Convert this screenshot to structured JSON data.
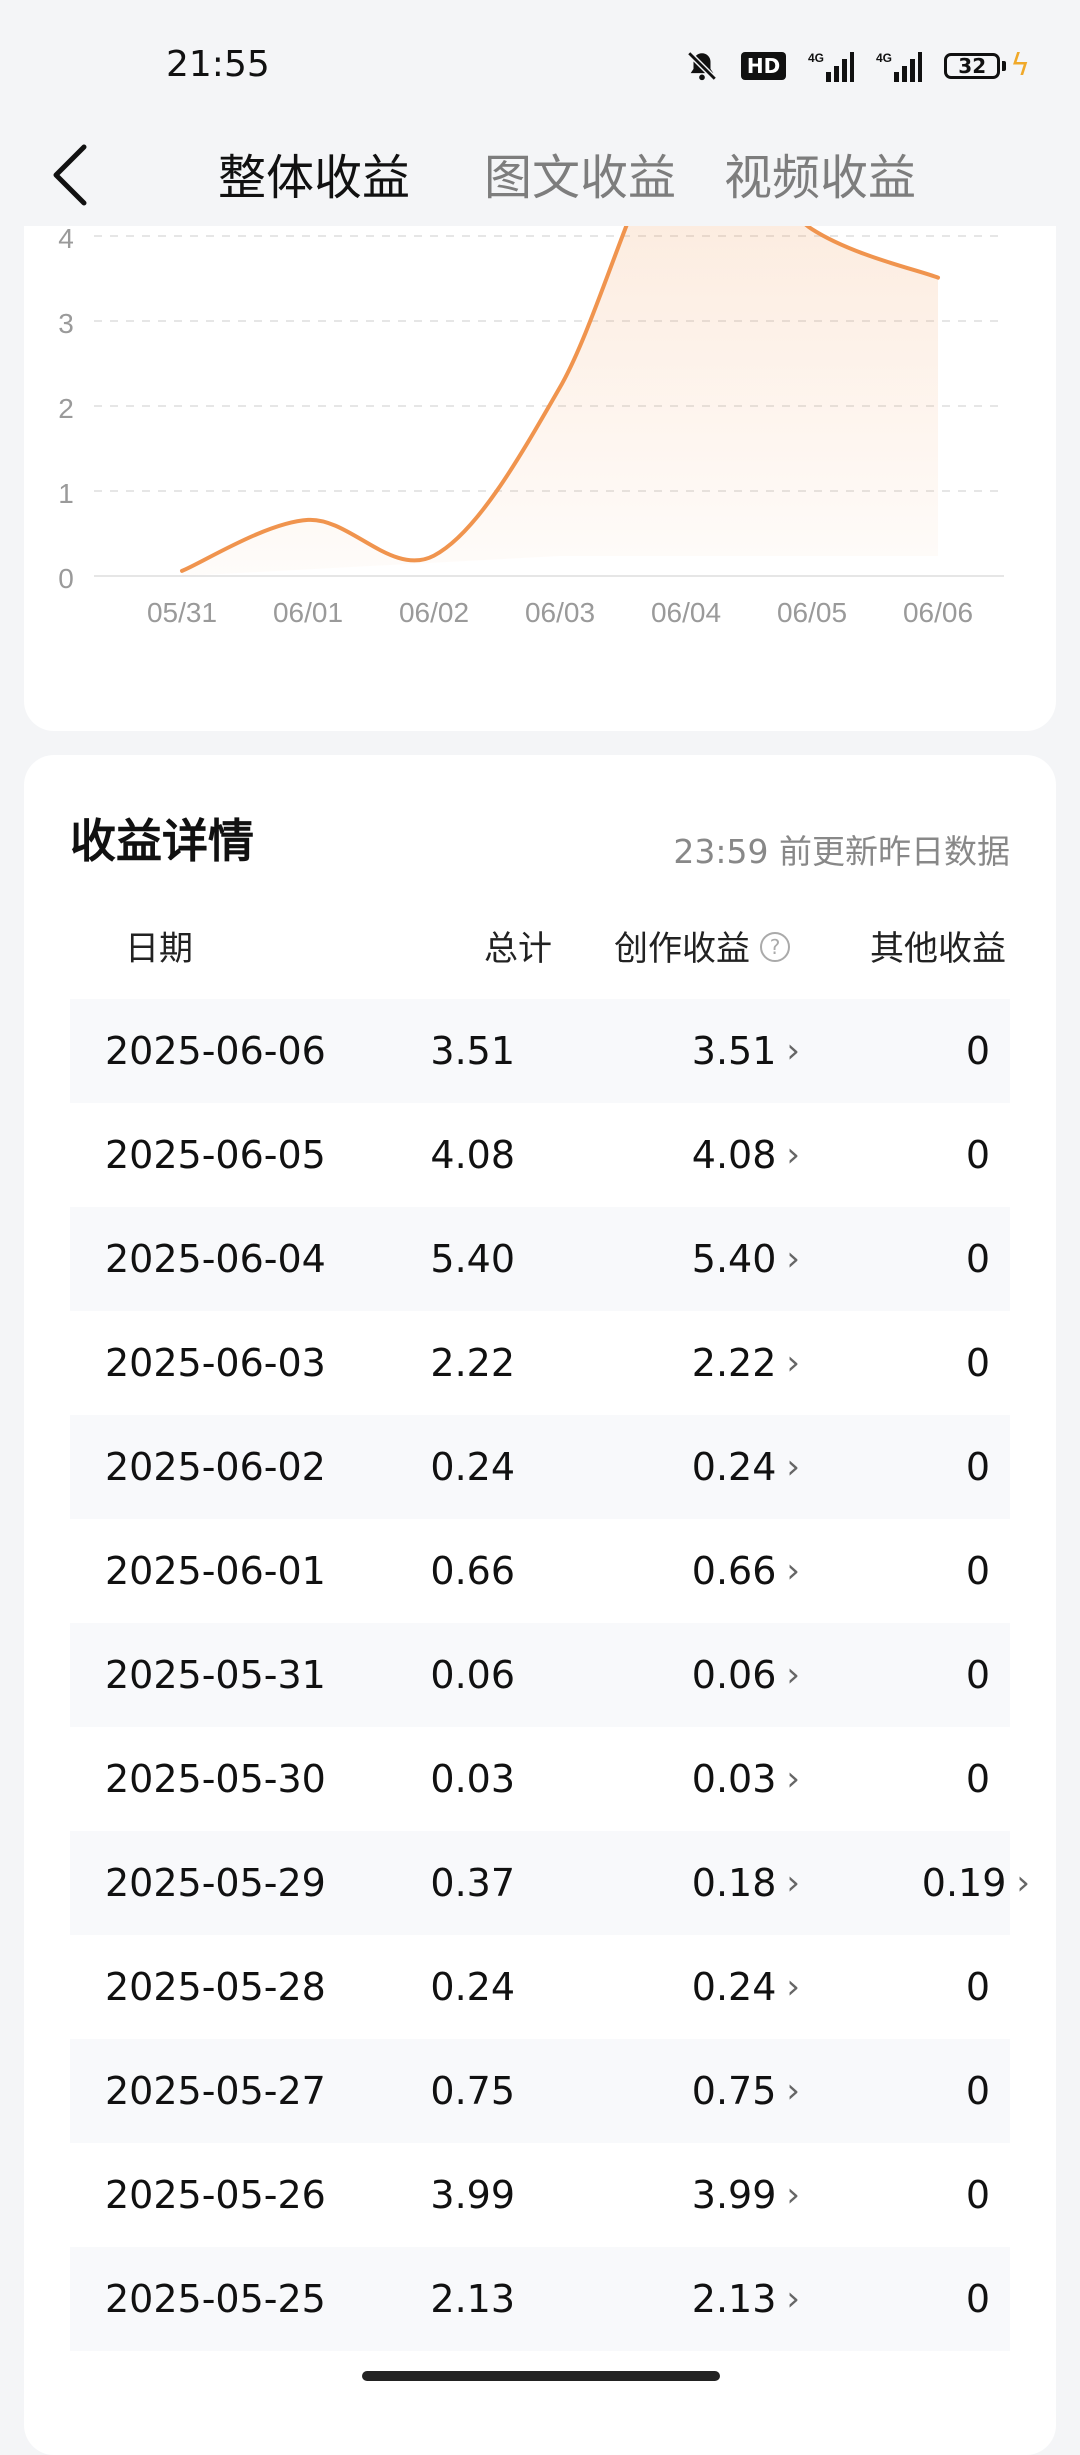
{
  "status": {
    "time": "21:55",
    "battery": "32",
    "network": "4G",
    "hd": "HD"
  },
  "header": {
    "tabs": [
      {
        "label": "整体收益",
        "active": true
      },
      {
        "label": "图文收益",
        "active": false
      },
      {
        "label": "视频收益",
        "active": false
      }
    ]
  },
  "chart_data": {
    "type": "area",
    "categories": [
      "05/31",
      "06/01",
      "06/02",
      "06/03",
      "06/04",
      "06/05",
      "06/06"
    ],
    "values": [
      0.06,
      0.66,
      0.24,
      2.22,
      5.4,
      4.08,
      3.51
    ],
    "y_ticks": [
      "0",
      "1",
      "2",
      "3",
      "4"
    ],
    "ylim": [
      0,
      4.4
    ],
    "grid": true,
    "color": "#f0944e"
  },
  "detail": {
    "title": "收益详情",
    "note": "23:59 前更新昨日数据",
    "columns": {
      "date": "日期",
      "total": "总计",
      "creation": "创作收益",
      "other": "其他收益"
    },
    "help_glyph": "?",
    "rows": [
      {
        "date": "2025-06-06",
        "total": "3.51",
        "creation": "3.51",
        "other": "0"
      },
      {
        "date": "2025-06-05",
        "total": "4.08",
        "creation": "4.08",
        "other": "0"
      },
      {
        "date": "2025-06-04",
        "total": "5.40",
        "creation": "5.40",
        "other": "0"
      },
      {
        "date": "2025-06-03",
        "total": "2.22",
        "creation": "2.22",
        "other": "0"
      },
      {
        "date": "2025-06-02",
        "total": "0.24",
        "creation": "0.24",
        "other": "0"
      },
      {
        "date": "2025-06-01",
        "total": "0.66",
        "creation": "0.66",
        "other": "0"
      },
      {
        "date": "2025-05-31",
        "total": "0.06",
        "creation": "0.06",
        "other": "0"
      },
      {
        "date": "2025-05-30",
        "total": "0.03",
        "creation": "0.03",
        "other": "0"
      },
      {
        "date": "2025-05-29",
        "total": "0.37",
        "creation": "0.18",
        "other": "0.19"
      },
      {
        "date": "2025-05-28",
        "total": "0.24",
        "creation": "0.24",
        "other": "0"
      },
      {
        "date": "2025-05-27",
        "total": "0.75",
        "creation": "0.75",
        "other": "0"
      },
      {
        "date": "2025-05-26",
        "total": "3.99",
        "creation": "3.99",
        "other": "0"
      },
      {
        "date": "2025-05-25",
        "total": "2.13",
        "creation": "2.13",
        "other": "0"
      }
    ]
  }
}
